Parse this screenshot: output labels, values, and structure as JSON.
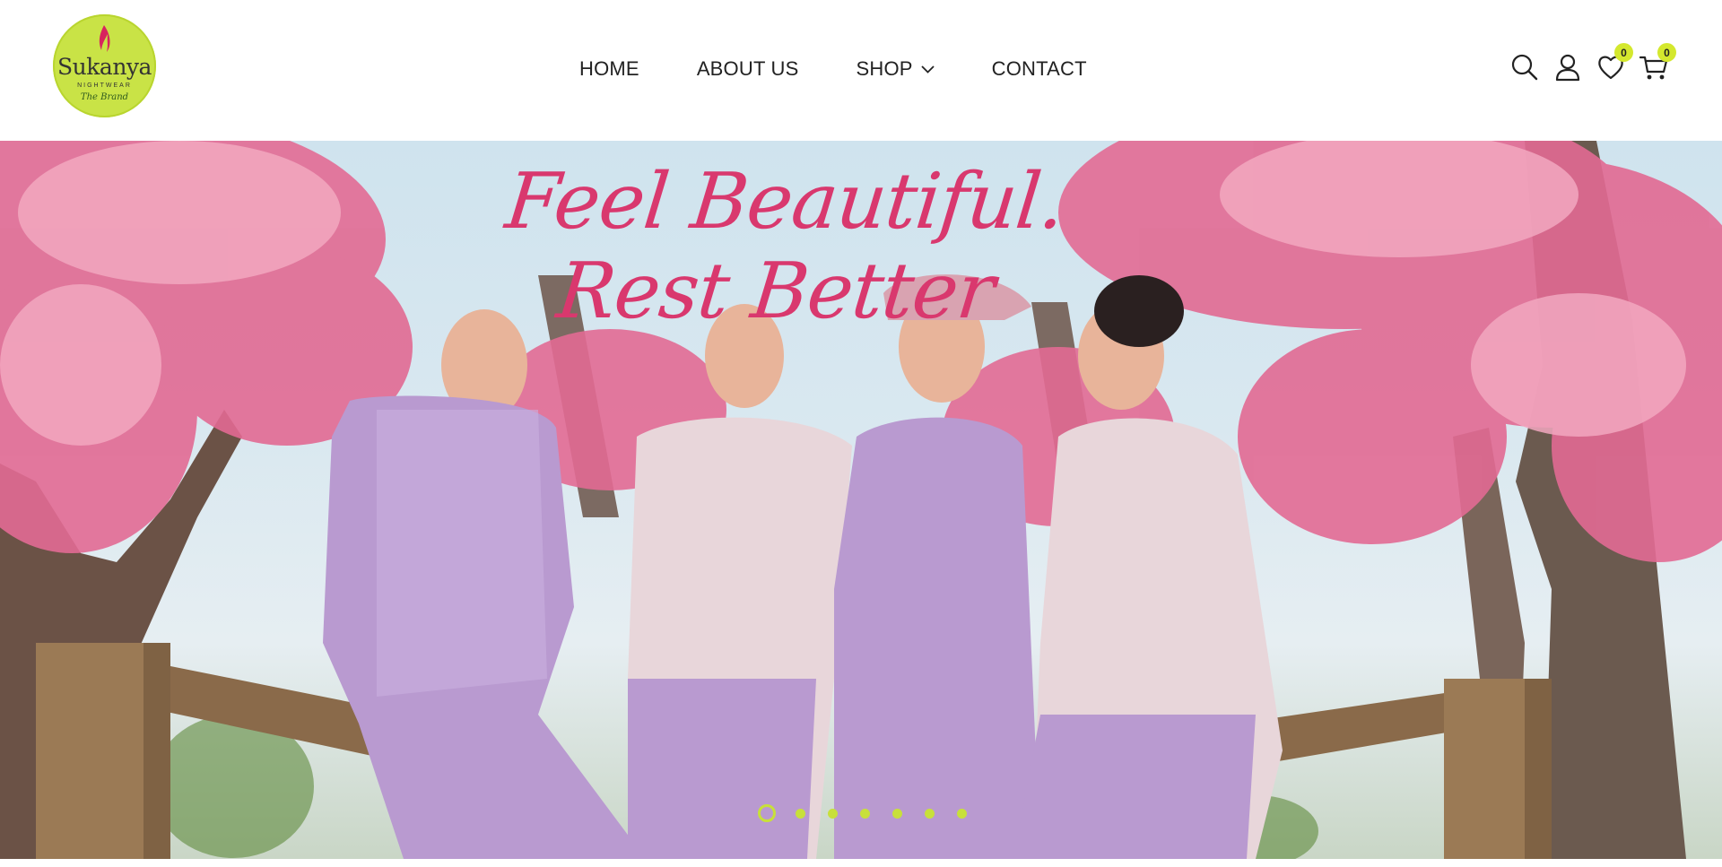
{
  "brand": {
    "name": "Sukanya",
    "sub": "NIGHTWEAR",
    "tagline": "The Brand",
    "logo_color": "#c9e346"
  },
  "nav": {
    "items": [
      {
        "label": "HOME"
      },
      {
        "label": "ABOUT US"
      },
      {
        "label": "SHOP",
        "has_dropdown": true
      },
      {
        "label": "CONTACT"
      }
    ]
  },
  "header_icons": {
    "search": "search-icon",
    "account": "user-icon",
    "wishlist": {
      "icon": "heart-icon",
      "count": "0"
    },
    "cart": {
      "icon": "cart-icon",
      "count": "0"
    },
    "badge_color": "#d4e82e"
  },
  "hero": {
    "headline": "Feel Beautiful. Rest Better",
    "headline_color": "#d9386e",
    "slides": 7,
    "active_slide": 1,
    "dot_color": "#c8e03a"
  }
}
